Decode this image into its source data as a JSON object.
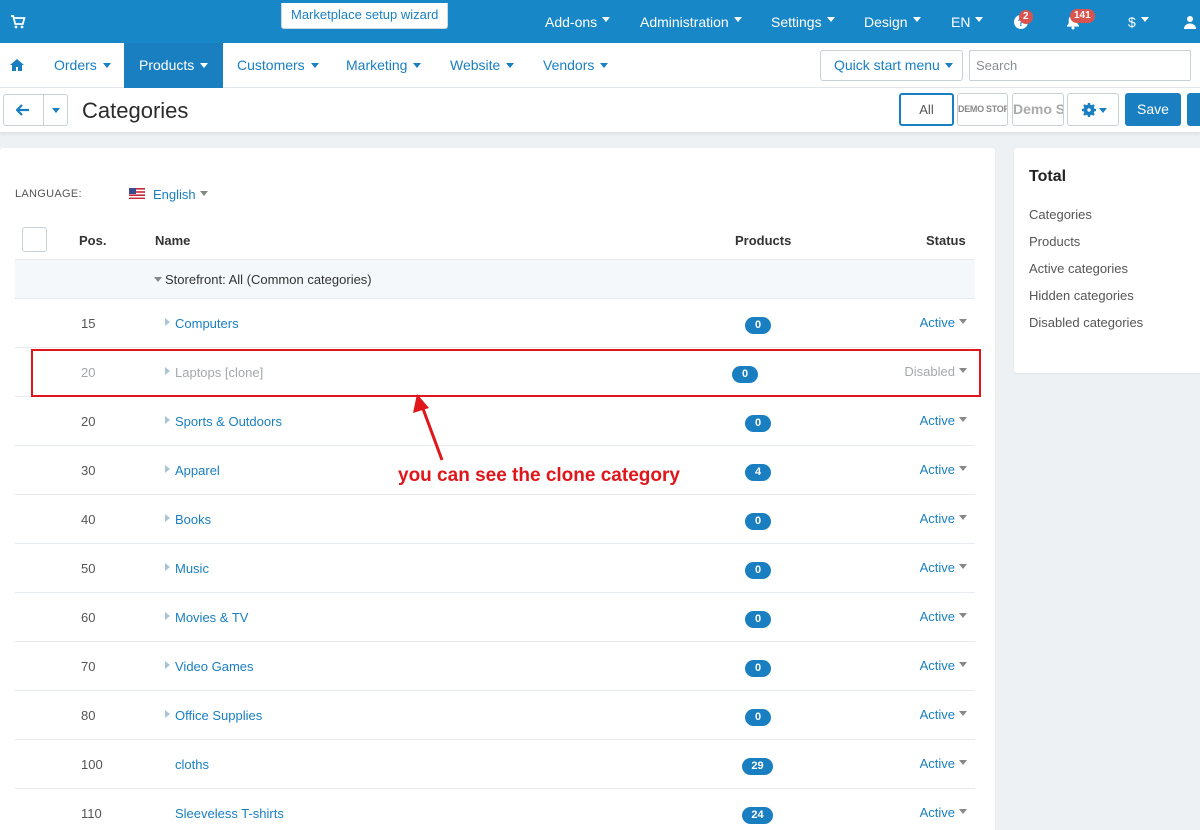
{
  "topbar": {
    "wizard_label": "Marketplace setup wizard",
    "menu": [
      "Add-ons",
      "Administration",
      "Settings",
      "Design",
      "EN"
    ],
    "help_badge": "2",
    "notifications_badge": "141",
    "currency": "$",
    "accent_color": "#1887c7"
  },
  "nav": {
    "items": [
      "Orders",
      "Products",
      "Customers",
      "Marketing",
      "Website",
      "Vendors"
    ],
    "active": "Products",
    "quick_start_label": "Quick start menu",
    "search_placeholder": "Search"
  },
  "titlebar": {
    "page_title": "Categories",
    "all_label": "All",
    "demo_store_small": "DEMO STORE",
    "demo_store_large": "Demo Store",
    "save_label": "Save"
  },
  "filters": {
    "language_label": "LANGUAGE:",
    "language_value": "English"
  },
  "table": {
    "headers": {
      "pos": "Pos.",
      "name": "Name",
      "products": "Products",
      "status": "Status"
    },
    "group_label": "Storefront: All (Common categories)",
    "rows": [
      {
        "pos": "15",
        "name": "Computers",
        "products": "0",
        "status": "Active"
      },
      {
        "pos": "20",
        "name": "Laptops [clone]",
        "products": "0",
        "status": "Disabled"
      },
      {
        "pos": "20",
        "name": "Sports & Outdoors",
        "products": "0",
        "status": "Active"
      },
      {
        "pos": "30",
        "name": "Apparel",
        "products": "4",
        "status": "Active"
      },
      {
        "pos": "40",
        "name": "Books",
        "products": "0",
        "status": "Active"
      },
      {
        "pos": "50",
        "name": "Music",
        "products": "0",
        "status": "Active"
      },
      {
        "pos": "60",
        "name": "Movies & TV",
        "products": "0",
        "status": "Active"
      },
      {
        "pos": "70",
        "name": "Video Games",
        "products": "0",
        "status": "Active"
      },
      {
        "pos": "80",
        "name": "Office Supplies",
        "products": "0",
        "status": "Active"
      },
      {
        "pos": "100",
        "name": "cloths",
        "products": "29",
        "status": "Active"
      },
      {
        "pos": "110",
        "name": "Sleeveless T-shirts",
        "products": "24",
        "status": "Active"
      }
    ]
  },
  "annotation": {
    "text": "you can see the clone category",
    "color": "#e0161b"
  },
  "sidebar": {
    "title": "Total",
    "items": [
      "Categories",
      "Products",
      "Active categories",
      "Hidden categories",
      "Disabled categories"
    ]
  }
}
